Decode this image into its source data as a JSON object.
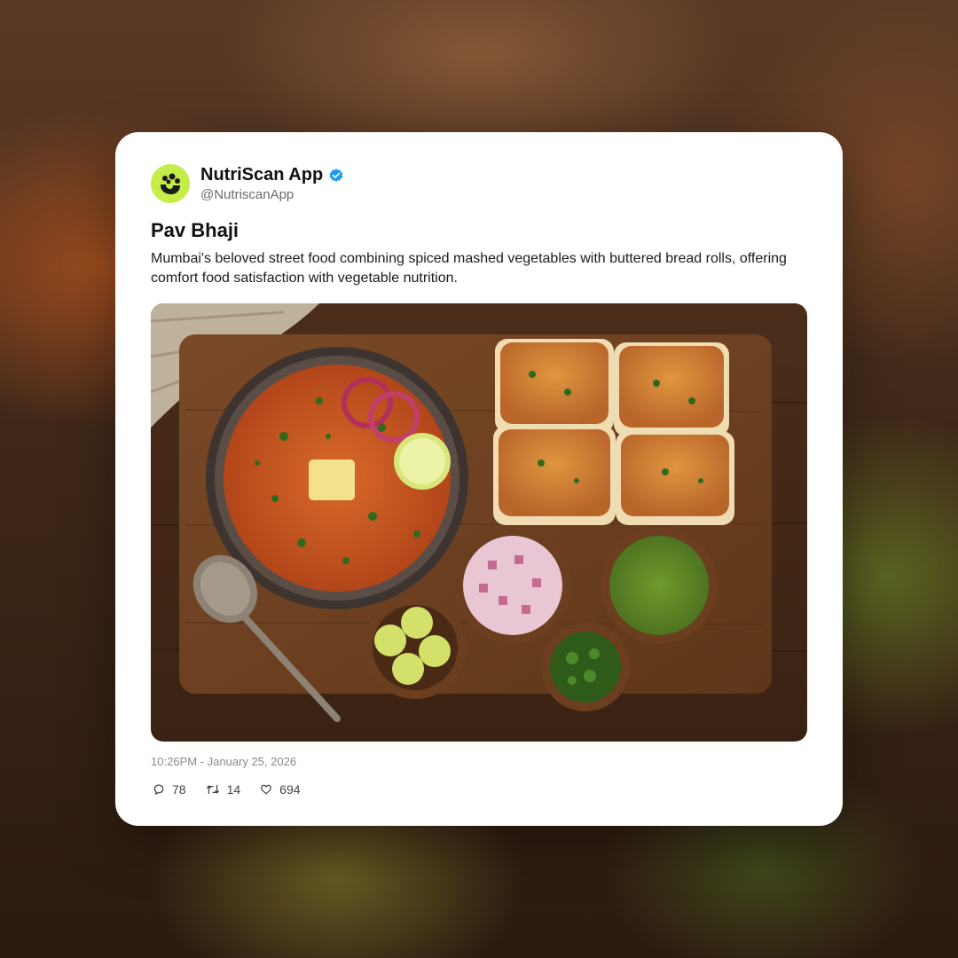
{
  "post": {
    "author_name": "NutriScan App",
    "handle": "@NutriscanApp",
    "verified_icon": "verified-badge-icon",
    "avatar_color": "#c6ec4a",
    "verified_color": "#1d9bf0",
    "title": "Pav Bhaji",
    "description": "Mumbai's beloved street food combining spiced mashed vegetables with buttered bread rolls, offering comfort food satisfaction with vegetable nutrition.",
    "timestamp": "10:26PM - January 25, 2026",
    "stats": {
      "replies": "78",
      "retweets": "14",
      "likes": "694"
    },
    "icons": {
      "reply": "speech-bubble-icon",
      "retweet": "retweet-icon",
      "like": "heart-icon"
    }
  }
}
